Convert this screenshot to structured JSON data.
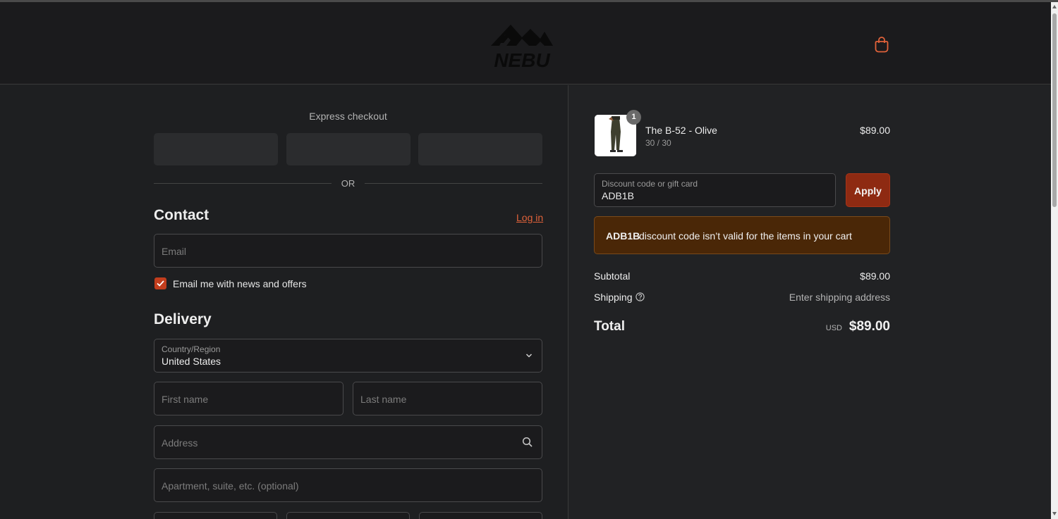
{
  "header": {
    "logo_text": "NEBU",
    "cart_icon": "shopping-bag-icon"
  },
  "express": {
    "title": "Express checkout",
    "or_text": "OR"
  },
  "contact": {
    "title": "Contact",
    "login_label": "Log in",
    "email_placeholder": "Email",
    "newsletter_label": "Email me with news and offers",
    "newsletter_checked": true
  },
  "delivery": {
    "title": "Delivery",
    "country_label": "Country/Region",
    "country_value": "United States",
    "first_name_placeholder": "First name",
    "last_name_placeholder": "Last name",
    "address_placeholder": "Address",
    "apartment_placeholder": "Apartment, suite, etc. (optional)"
  },
  "order": {
    "item": {
      "quantity": "1",
      "name": "The B-52 - Olive",
      "variant": "30 / 30",
      "price": "$89.00"
    },
    "discount_label": "Discount code or gift card",
    "discount_value": "ADB1B",
    "apply_label": "Apply",
    "error_code": "ADB1B",
    "error_message": "discount code isn’t valid for the items in your cart",
    "subtotal_label": "Subtotal",
    "subtotal_value": "$89.00",
    "shipping_label": "Shipping",
    "shipping_value": "Enter shipping address",
    "total_label": "Total",
    "total_currency": "USD",
    "total_value": "$89.00"
  },
  "colors": {
    "accent": "#c23d1d",
    "link": "#e0623a",
    "alert_bg": "#4a2707"
  }
}
